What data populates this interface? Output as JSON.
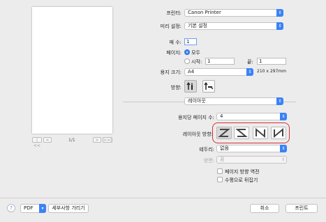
{
  "printer": {
    "label": "프린터:",
    "value": "Canon Printer"
  },
  "preset": {
    "label": "미리 설정:",
    "value": "기본 설정"
  },
  "copies": {
    "label": "매 수:",
    "value": "1"
  },
  "pages": {
    "label": "페이지:",
    "all_label": "모두",
    "from_label": "시작:",
    "from_value": "1",
    "to_label": "끝:",
    "to_value": "1"
  },
  "paper_size": {
    "label": "용지 크기:",
    "value": "A4",
    "dimensions": "210 x 297mm"
  },
  "orientation": {
    "label": "방향:"
  },
  "section_popup": {
    "value": "레이아웃"
  },
  "pages_per_sheet": {
    "label": "용지당 페이지 수:",
    "value": "4"
  },
  "layout_direction": {
    "label": "레이아웃 방향:",
    "highlight_color": "#d83030"
  },
  "border": {
    "label": "테두리:",
    "value": "없음"
  },
  "two_sided": {
    "label": "양면:",
    "value": "끔"
  },
  "reverse_orientation": {
    "label": "페이지 방향 역전"
  },
  "flip_horizontal": {
    "label": "수평으로 뒤집기"
  },
  "preview_nav": {
    "first": "|<<",
    "prev": "<",
    "page": "1/1",
    "next": ">",
    "last": ">>|"
  },
  "bottom": {
    "help": "?",
    "pdf": "PDF",
    "hide_details": "세부사항 가리기",
    "cancel": "취소",
    "print": "프린트"
  },
  "colors": {
    "accent": "#3b82f7"
  }
}
